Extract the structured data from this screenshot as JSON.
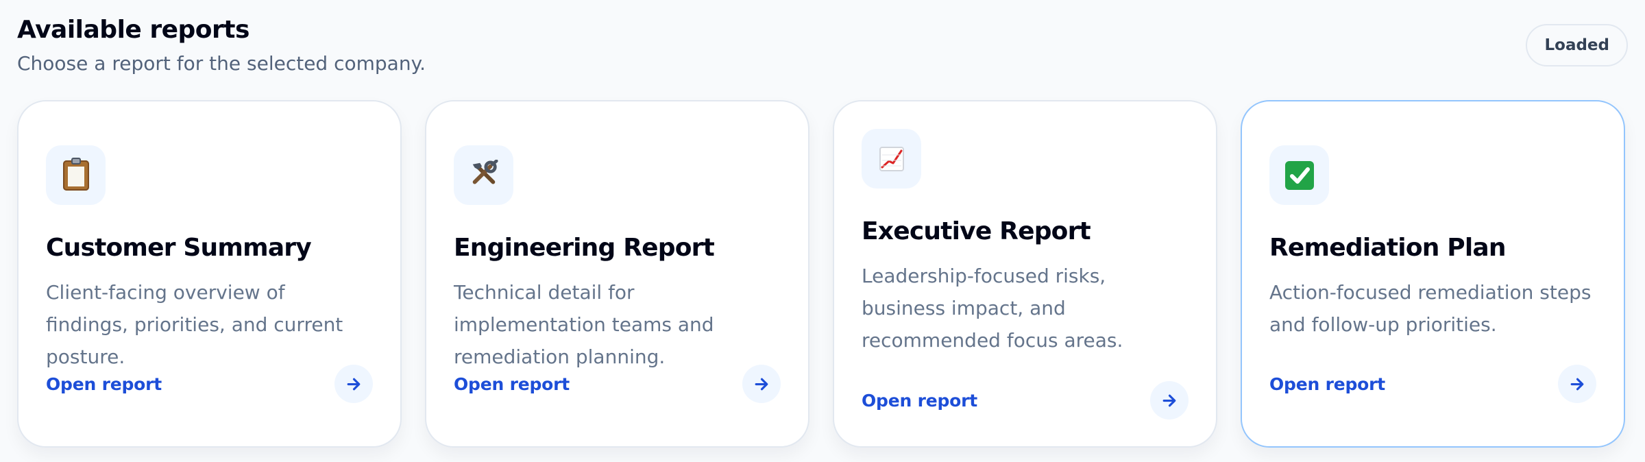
{
  "header": {
    "title": "Available reports",
    "subtitle": "Choose a report for the selected company.",
    "status": "Loaded"
  },
  "cards": [
    {
      "icon": "clipboard-icon",
      "title": "Customer Summary",
      "description": "Client-facing overview of findings, priorities, and current posture.",
      "link": "Open report"
    },
    {
      "icon": "hammer-wrench-icon",
      "title": "Engineering Report",
      "description": "Technical detail for implementation teams and remediation planning.",
      "link": "Open report"
    },
    {
      "icon": "chart-up-icon",
      "title": "Executive Report",
      "description": "Leadership-focused risks, business impact, and recommended focus areas.",
      "link": "Open report"
    },
    {
      "icon": "check-mark-icon",
      "title": "Remediation Plan",
      "description": "Action-focused remediation steps and follow-up priorities.",
      "link": "Open report"
    }
  ],
  "colors": {
    "accent": "#1d4ed8",
    "icon_background": "#eff6ff",
    "selected_border": "#93c5fd"
  }
}
